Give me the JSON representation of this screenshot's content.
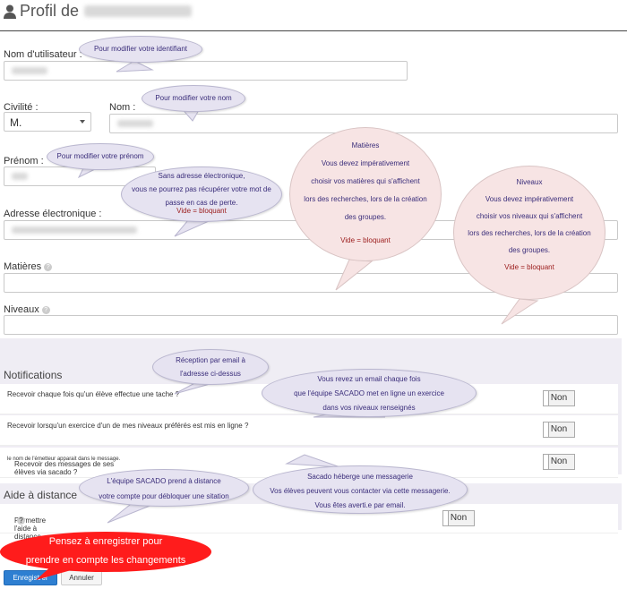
{
  "header": {
    "title_prefix": "Profil de"
  },
  "form": {
    "username_label": "Nom d'utilisateur :",
    "civility_label": "Civilité :",
    "civility_value": "M.",
    "lastname_label": "Nom :",
    "firstname_label": "Prénom :",
    "email_label": "Adresse électronique :",
    "subjects_label": "Matières",
    "levels_label": "Niveaux"
  },
  "notifications": {
    "title": "Notifications",
    "rows": [
      {
        "label": "Recevoir chaque fois qu'un élève effectue une tache ?",
        "value": "Non"
      },
      {
        "label": "Recevoir lorsqu'un exercice d'un de mes niveaux préférés est mis en ligne ?",
        "value": "Non"
      },
      {
        "label": "Recevoir des messages de ses élèves via sacado ?",
        "hint": "le nom de l'émetteur apparait dans le message.",
        "value": "Non"
      }
    ]
  },
  "remote": {
    "title": "Aide à distance",
    "row_label": "Permettre l'aide à distance ?",
    "value": "Non"
  },
  "buttons": {
    "save": "Enregistrer",
    "cancel": "Annuler"
  },
  "callouts": {
    "username": "Pour modifier votre identifiant",
    "lastname": "Pour modifier votre nom",
    "firstname": "Pour modifier votre prénom",
    "email": [
      "Sans adresse électronique,",
      "vous ne pourrez pas récupérer votre mot de",
      "passe en cas de perte.",
      "Vide = bloquant"
    ],
    "subjects": [
      "Matières",
      "Vous devez impérativement",
      "choisir vos matières qui s'affichent",
      "lors des recherches, lors de la création",
      "des groupes.",
      "Vide = bloquant"
    ],
    "levels": [
      "Niveaux",
      "Vous devez impérativement",
      "choisir vos niveaux qui s'affichent",
      "lors des recherches, lors de la création",
      "des groupes.",
      "Vide = bloquant"
    ],
    "notif_email": [
      "Réception par email à",
      "l'adresse ci-dessus"
    ],
    "exercise": [
      "Vous revez un email chaque fois",
      "que l'équipe SACADO met en ligne un exercice",
      "dans vos niveaux renseignés"
    ],
    "remote": [
      "L'équipe SACADO prend à distance",
      "votre compte pour débloquer une sitation"
    ],
    "messages": [
      "Sacado héberge une messagerie",
      "Vos élèves peuvent vous contacter via cette messagerie.",
      "Vous êtes averti.e par email."
    ],
    "save_reminder": [
      "Pensez à enregistrer pour",
      "prendre en compte les changements"
    ]
  },
  "colors": {
    "bubble": "#e6e3f1",
    "bubble_pink": "#f7e4e4",
    "reminder": "#ff1c1c",
    "save_button": "#2e7fd1",
    "panel": "#efedf4"
  }
}
